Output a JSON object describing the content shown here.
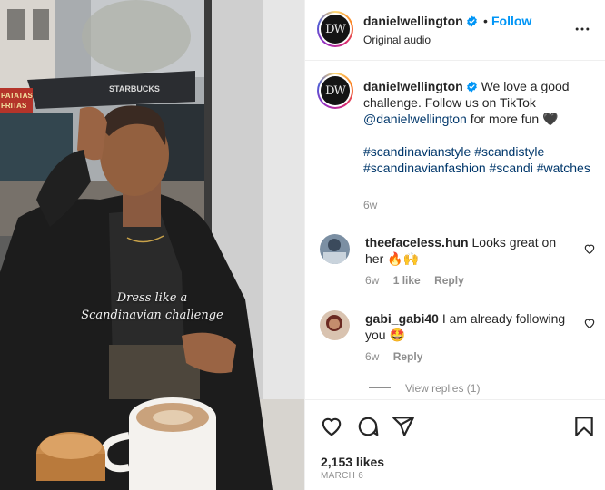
{
  "media": {
    "overlay_caption": {
      "line1": "Dress like a",
      "line2": "Scandinavian challenge"
    },
    "storefront_sign": "STARBUCKS",
    "side_sign_line1": "PATATAS",
    "side_sign_line2": "FRITAS"
  },
  "header": {
    "username": "danielwellington",
    "avatar_text": "DW",
    "separator": "•",
    "follow_label": "Follow",
    "audio": "Original audio"
  },
  "caption": {
    "username": "danielwellington",
    "text_before_mention": "We love a good challenge. Follow us on TikTok",
    "mention": "@danielwellington",
    "text_after_mention": "for more fun 🖤",
    "hashtags": [
      "#scandinavianstyle",
      "#scandistyle",
      "#scandinavianfashion",
      "#scandi",
      "#watches"
    ],
    "time": "6w"
  },
  "comments": [
    {
      "username": "theefaceless.hun",
      "text": "Looks great on her",
      "emoji": "🔥🙌",
      "time": "6w",
      "likes": "1 like",
      "reply_label": "Reply"
    },
    {
      "username": "gabi_gabi40",
      "text": "I am already following you",
      "emoji": "🤩",
      "time": "6w",
      "reply_label": "Reply",
      "view_replies": "View replies (1)"
    }
  ],
  "actions": {
    "icons": [
      "heart-icon",
      "comment-icon",
      "share-icon",
      "bookmark-icon"
    ],
    "likes_count": "2,153 likes",
    "date": "MARCH 6"
  },
  "colors": {
    "accent_blue": "#0095f6",
    "link_navy": "#00376b",
    "muted_gray": "#8e8e8e",
    "text_dark": "#262626"
  }
}
